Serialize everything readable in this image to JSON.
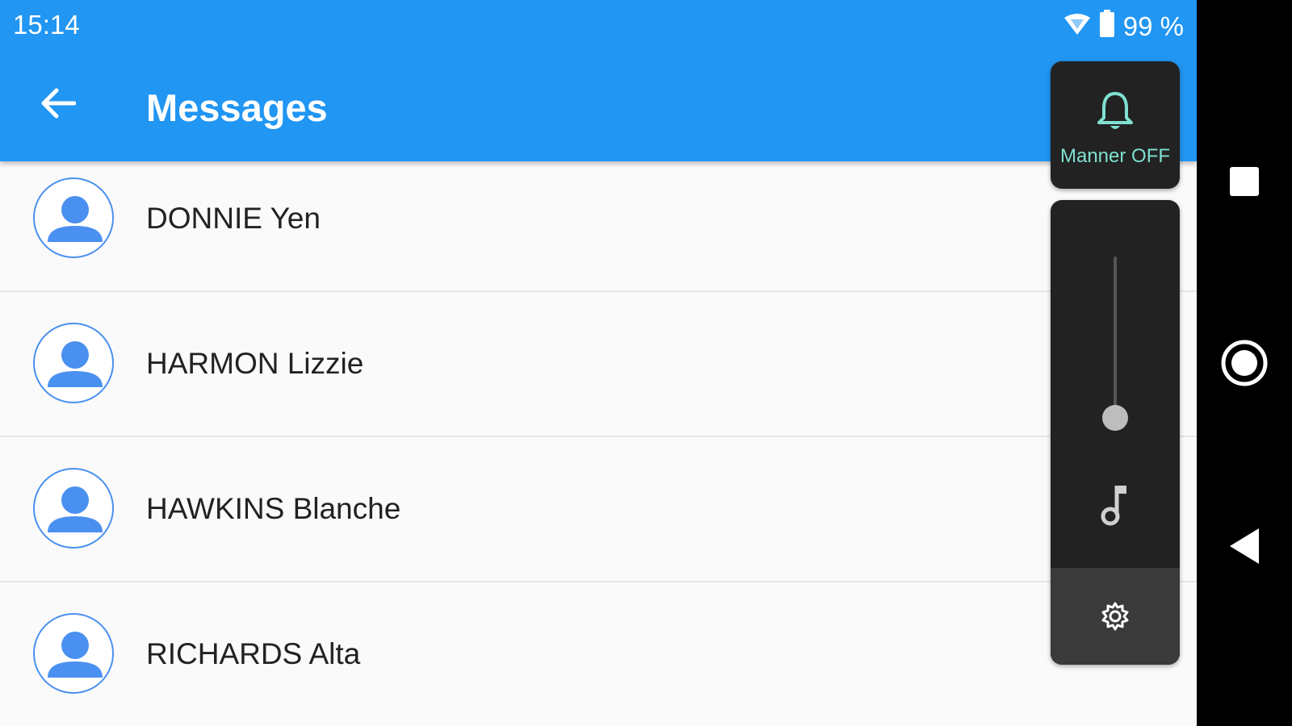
{
  "status_bar": {
    "time": "15:14",
    "battery": "99 %"
  },
  "app_bar": {
    "title": "Messages"
  },
  "contacts": [
    {
      "name": "DONNIE Yen"
    },
    {
      "name": "HARMON Lizzie"
    },
    {
      "name": "HAWKINS Blanche"
    },
    {
      "name": "RICHARDS Alta"
    }
  ],
  "volume_panel": {
    "manner_label": "Manner OFF",
    "level": 0.0
  },
  "colors": {
    "app_bar": "#2196f3",
    "avatar_accent": "#4a90f0",
    "manner_text": "#7fe0d0"
  },
  "icons": [
    "back-arrow-icon",
    "wifi-icon",
    "battery-icon",
    "person-icon",
    "bell-icon",
    "music-note-icon",
    "gear-icon",
    "recents-square-icon",
    "home-circle-icon",
    "back-triangle-icon"
  ]
}
